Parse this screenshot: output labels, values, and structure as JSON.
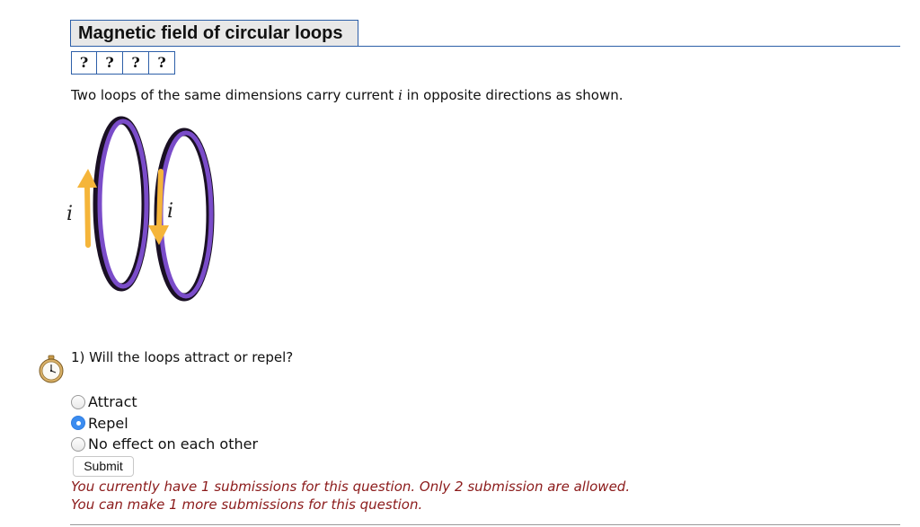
{
  "header": {
    "title": "Magnetic field of circular loops"
  },
  "help_buttons": [
    "?",
    "?",
    "?",
    "?"
  ],
  "prompt": {
    "before": "Two loops of the same dimensions carry current ",
    "variable": "i",
    "after": " in opposite directions as shown."
  },
  "figure": {
    "left_label": "i",
    "right_label": "i",
    "loop_color": "#7a4cc9",
    "arrow_color": "#f5b53a"
  },
  "question": {
    "text": "1) Will the loops attract or repel?",
    "options": [
      {
        "label": "Attract",
        "selected": false
      },
      {
        "label": "Repel",
        "selected": true
      },
      {
        "label": "No effect on each other",
        "selected": false
      }
    ],
    "submit_label": "Submit"
  },
  "messages": {
    "line1": "You currently have 1 submissions for this question. Only 2 submission are allowed.",
    "line2": "You can make 1 more submissions for this question."
  },
  "colors": {
    "accent": "#2d5fa8",
    "message": "#8b1a1a",
    "radio_selected": "#3b8cf0"
  }
}
